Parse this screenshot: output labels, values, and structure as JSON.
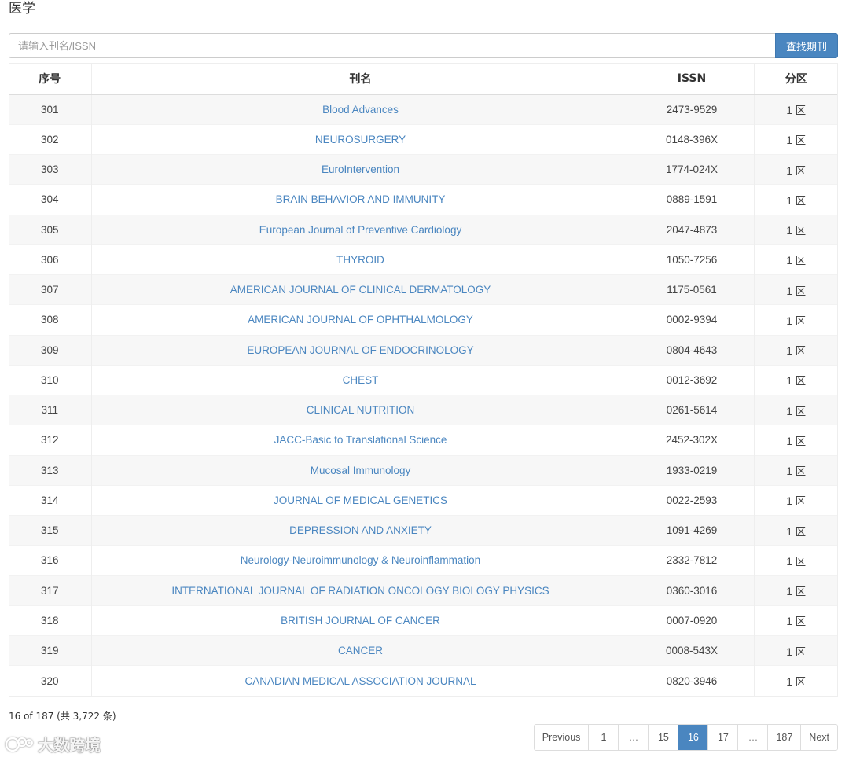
{
  "header": {
    "title": "医学"
  },
  "search": {
    "placeholder": "请输入刊名/ISSN",
    "button_label": "查找期刊"
  },
  "table": {
    "columns": [
      "序号",
      "刊名",
      "ISSN",
      "分区"
    ],
    "rows": [
      {
        "no": "301",
        "name": "Blood Advances",
        "issn": "2473-9529",
        "zone": "1 区"
      },
      {
        "no": "302",
        "name": "NEUROSURGERY",
        "issn": "0148-396X",
        "zone": "1 区"
      },
      {
        "no": "303",
        "name": "EuroIntervention",
        "issn": "1774-024X",
        "zone": "1 区"
      },
      {
        "no": "304",
        "name": "BRAIN BEHAVIOR AND IMMUNITY",
        "issn": "0889-1591",
        "zone": "1 区"
      },
      {
        "no": "305",
        "name": "European Journal of Preventive Cardiology",
        "issn": "2047-4873",
        "zone": "1 区"
      },
      {
        "no": "306",
        "name": "THYROID",
        "issn": "1050-7256",
        "zone": "1 区"
      },
      {
        "no": "307",
        "name": "AMERICAN JOURNAL OF CLINICAL DERMATOLOGY",
        "issn": "1175-0561",
        "zone": "1 区"
      },
      {
        "no": "308",
        "name": "AMERICAN JOURNAL OF OPHTHALMOLOGY",
        "issn": "0002-9394",
        "zone": "1 区"
      },
      {
        "no": "309",
        "name": "EUROPEAN JOURNAL OF ENDOCRINOLOGY",
        "issn": "0804-4643",
        "zone": "1 区"
      },
      {
        "no": "310",
        "name": "CHEST",
        "issn": "0012-3692",
        "zone": "1 区"
      },
      {
        "no": "311",
        "name": "CLINICAL NUTRITION",
        "issn": "0261-5614",
        "zone": "1 区"
      },
      {
        "no": "312",
        "name": "JACC-Basic to Translational Science",
        "issn": "2452-302X",
        "zone": "1 区"
      },
      {
        "no": "313",
        "name": "Mucosal Immunology",
        "issn": "1933-0219",
        "zone": "1 区"
      },
      {
        "no": "314",
        "name": "JOURNAL OF MEDICAL GENETICS",
        "issn": "0022-2593",
        "zone": "1 区"
      },
      {
        "no": "315",
        "name": "DEPRESSION AND ANXIETY",
        "issn": "1091-4269",
        "zone": "1 区"
      },
      {
        "no": "316",
        "name": "Neurology-Neuroimmunology & Neuroinflammation",
        "issn": "2332-7812",
        "zone": "1 区"
      },
      {
        "no": "317",
        "name": "INTERNATIONAL JOURNAL OF RADIATION ONCOLOGY BIOLOGY PHYSICS",
        "issn": "0360-3016",
        "zone": "1 区"
      },
      {
        "no": "318",
        "name": "BRITISH JOURNAL OF CANCER",
        "issn": "0007-0920",
        "zone": "1 区"
      },
      {
        "no": "319",
        "name": "CANCER",
        "issn": "0008-543X",
        "zone": "1 区"
      },
      {
        "no": "320",
        "name": "CANADIAN MEDICAL ASSOCIATION JOURNAL",
        "issn": "0820-3946",
        "zone": "1 区"
      }
    ]
  },
  "summary": "16 of 187 (共 3,722 条)",
  "pagination": {
    "items": [
      {
        "label": "Previous",
        "type": "nav"
      },
      {
        "label": "1",
        "type": "page"
      },
      {
        "label": "…",
        "type": "ellipsis"
      },
      {
        "label": "15",
        "type": "page"
      },
      {
        "label": "16",
        "type": "page",
        "active": true
      },
      {
        "label": "17",
        "type": "page"
      },
      {
        "label": "…",
        "type": "ellipsis"
      },
      {
        "label": "187",
        "type": "page"
      },
      {
        "label": "Next",
        "type": "nav"
      }
    ]
  },
  "watermark": {
    "text": "大数跨境",
    "icon": "logo-icon"
  },
  "colors": {
    "accent": "#4a86c0",
    "stripe": "#f7f7f7",
    "border": "#dddddd"
  }
}
